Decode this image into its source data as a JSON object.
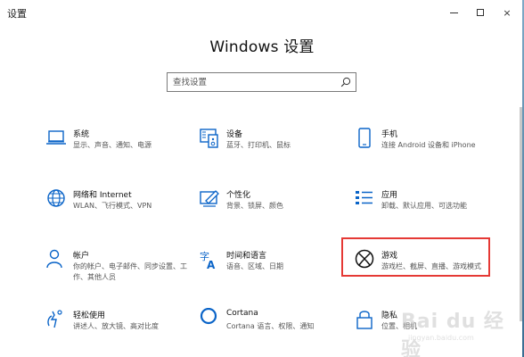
{
  "window": {
    "title": "设置",
    "controls": {
      "minimize": "minimize-icon",
      "maximize": "maximize-icon",
      "close": "×"
    }
  },
  "header": {
    "title": "Windows 设置"
  },
  "search": {
    "placeholder": "查找设置"
  },
  "items": [
    {
      "title": "系统",
      "desc": "显示、声音、通知、电源",
      "icon": "laptop-icon"
    },
    {
      "title": "设备",
      "desc": "蓝牙、打印机、鼠标",
      "icon": "devices-icon"
    },
    {
      "title": "手机",
      "desc": "连接 Android 设备和 iPhone",
      "icon": "phone-icon"
    },
    {
      "title": "网络和 Internet",
      "desc": "WLAN、飞行模式、VPN",
      "icon": "globe-icon"
    },
    {
      "title": "个性化",
      "desc": "背景、锁屏、颜色",
      "icon": "personalization-icon"
    },
    {
      "title": "应用",
      "desc": "卸载、默认应用、可选功能",
      "icon": "apps-icon"
    },
    {
      "title": "帐户",
      "desc": "你的帐户、电子邮件、同步设置、工作、其他人员",
      "icon": "person-icon"
    },
    {
      "title": "时间和语言",
      "desc": "语音、区域、日期",
      "icon": "time-language-icon"
    },
    {
      "title": "游戏",
      "desc": "游戏栏、截屏、直播、游戏模式",
      "icon": "xbox-icon"
    },
    {
      "title": "轻松使用",
      "desc": "讲述人、放大镜、高对比度",
      "icon": "ease-of-access-icon"
    },
    {
      "title": "Cortana",
      "desc": "Cortana 语言、权限、通知",
      "icon": "cortana-icon"
    },
    {
      "title": "隐私",
      "desc": "位置、相机",
      "icon": "lock-icon"
    }
  ],
  "highlight_color": "#e53935",
  "accent_color": "#0a64c8",
  "watermark": {
    "logo": "Bai du 经验",
    "url": "jingyan.baidu.com"
  }
}
